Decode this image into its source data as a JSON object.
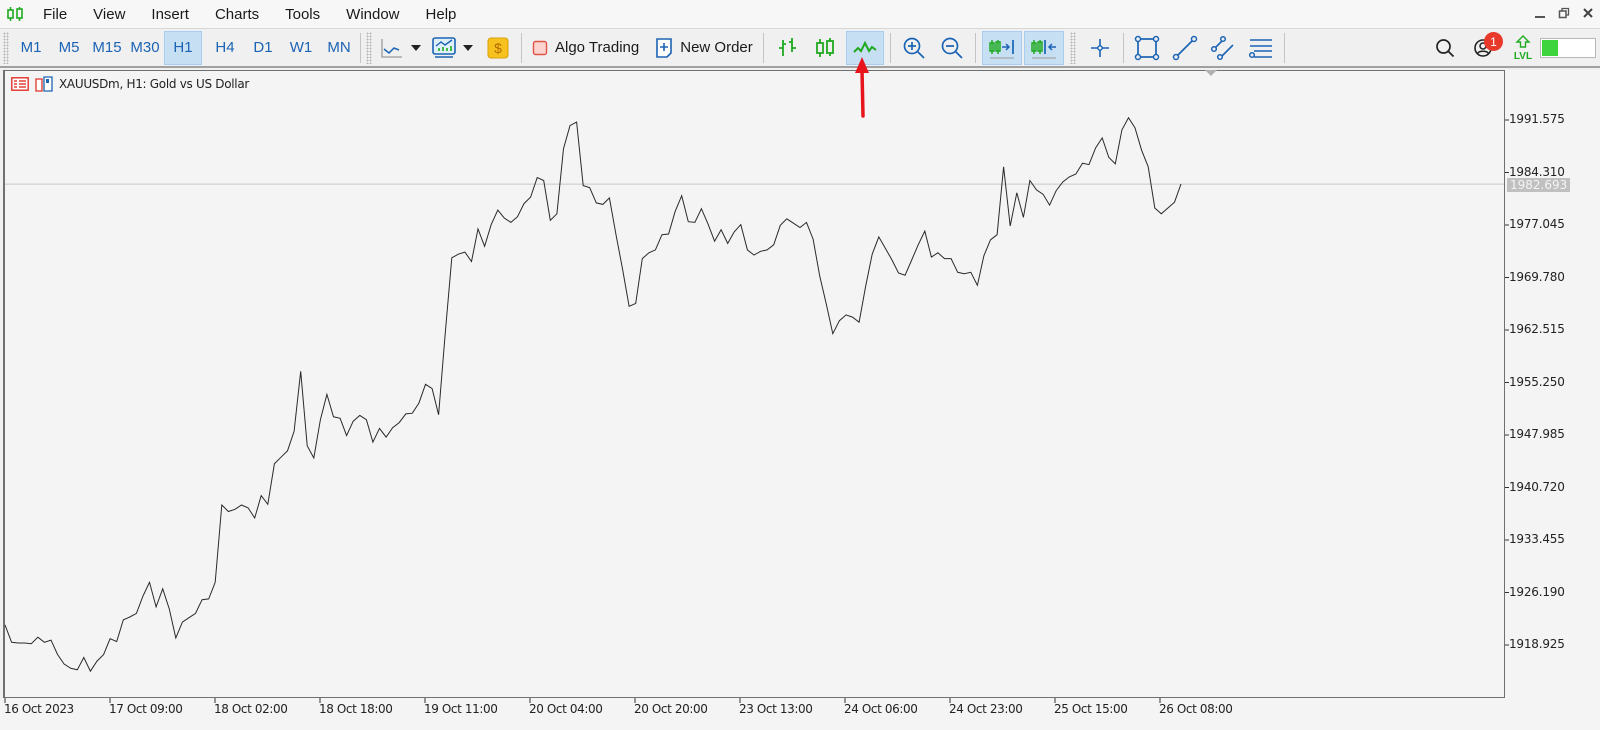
{
  "menubar": {
    "app_icon": "candlestick-logo-icon",
    "items": [
      "File",
      "View",
      "Insert",
      "Charts",
      "Tools",
      "Window",
      "Help"
    ],
    "window_controls": [
      "minimize",
      "restore",
      "close"
    ]
  },
  "toolbar": {
    "timeframes": [
      "M1",
      "M5",
      "M15",
      "M30",
      "H1",
      "H4",
      "D1",
      "W1",
      "MN"
    ],
    "active_timeframe": "H1",
    "algo_trading_label": "Algo Trading",
    "new_order_label": "New Order",
    "chart_type_active": "line-chart",
    "notification_count": "1",
    "level_label": "LVL",
    "level_progress": 0.3,
    "accent_color": "#1b63b4",
    "green_color": "#1faa1f",
    "annotation_arrow_color": "#e8141c"
  },
  "chart": {
    "symbol_title": "XAUUSDm, H1:  Gold vs US Dollar",
    "current_price": "1982.693"
  },
  "chart_data": {
    "type": "line",
    "title": "XAUUSDm, H1: Gold vs US Dollar",
    "xlabel": "",
    "ylabel": "",
    "x_tick_labels": [
      "16 Oct 2023",
      "17 Oct 09:00",
      "18 Oct 02:00",
      "18 Oct 18:00",
      "19 Oct 11:00",
      "20 Oct 04:00",
      "20 Oct 20:00",
      "23 Oct 13:00",
      "24 Oct 06:00",
      "24 Oct 23:00",
      "25 Oct 15:00",
      "26 Oct 08:00"
    ],
    "y_tick_labels": [
      "1991.575",
      "1984.310",
      "1977.045",
      "1969.780",
      "1962.515",
      "1955.250",
      "1947.985",
      "1940.720",
      "1933.455",
      "1926.190",
      "1918.925"
    ],
    "ylim": [
      1915.0,
      1994.5
    ],
    "current_price_line": 1982.693,
    "grid": false,
    "bar_interval": "H1",
    "bars_between_ticks": 16,
    "values": [
      1921.7,
      1919.3,
      1919.2,
      1919.2,
      1919.1,
      1920.0,
      1919.3,
      1919.6,
      1917.6,
      1916.3,
      1915.7,
      1915.5,
      1917.2,
      1915.3,
      1916.7,
      1917.6,
      1919.8,
      1919.4,
      1922.4,
      1922.8,
      1923.3,
      1925.7,
      1927.6,
      1924.2,
      1926.7,
      1923.9,
      1919.9,
      1922.1,
      1922.7,
      1923.3,
      1925.2,
      1925.3,
      1927.6,
      1938.3,
      1937.4,
      1937.7,
      1938.3,
      1937.9,
      1936.5,
      1939.6,
      1938.4,
      1944.0,
      1944.9,
      1945.8,
      1948.5,
      1956.8,
      1946.5,
      1944.8,
      1950.1,
      1953.6,
      1950.5,
      1950.3,
      1947.9,
      1949.9,
      1950.7,
      1950.1,
      1947.0,
      1948.9,
      1947.7,
      1949.0,
      1949.7,
      1950.9,
      1951.0,
      1952.4,
      1955.0,
      1954.4,
      1950.8,
      1962.0,
      1972.5,
      1973.0,
      1973.3,
      1972.0,
      1976.5,
      1974.1,
      1977.1,
      1979.1,
      1978.0,
      1977.4,
      1978.2,
      1980.0,
      1980.9,
      1983.6,
      1983.2,
      1977.7,
      1978.6,
      1987.6,
      1990.8,
      1991.3,
      1982.5,
      1982.2,
      1980.1,
      1979.9,
      1980.8,
      1975.7,
      1970.9,
      1965.8,
      1966.2,
      1972.4,
      1973.2,
      1973.6,
      1975.7,
      1975.8,
      1978.9,
      1981.1,
      1977.5,
      1977.4,
      1979.3,
      1977.2,
      1974.8,
      1976.4,
      1974.5,
      1976.1,
      1977.1,
      1973.6,
      1972.9,
      1973.4,
      1973.6,
      1974.3,
      1977.0,
      1977.9,
      1977.3,
      1976.7,
      1977.4,
      1975.1,
      1970.0,
      1966.1,
      1962.0,
      1963.8,
      1964.6,
      1964.3,
      1963.6,
      1968.6,
      1973.0,
      1975.4,
      1973.8,
      1972.2,
      1970.4,
      1970.1,
      1972.2,
      1974.3,
      1976.2,
      1972.6,
      1973.2,
      1972.4,
      1972.4,
      1970.5,
      1970.3,
      1970.5,
      1968.7,
      1972.8,
      1975.0,
      1975.7,
      1985.1,
      1976.9,
      1981.5,
      1978.1,
      1983.2,
      1981.9,
      1981.3,
      1979.8,
      1981.8,
      1983.0,
      1983.7,
      1984.1,
      1985.6,
      1985.4,
      1987.7,
      1989.1,
      1986.4,
      1985.5,
      1990.2,
      1991.9,
      1990.5,
      1987.4,
      1985.1,
      1979.4,
      1978.6,
      1979.4,
      1980.2,
      1982.7
    ]
  }
}
